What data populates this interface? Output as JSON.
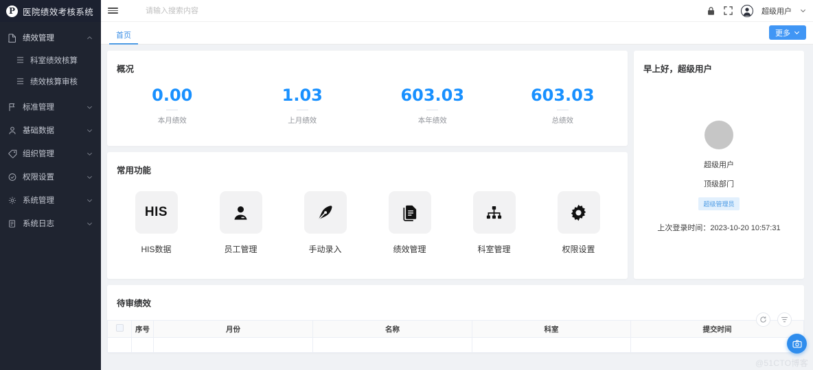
{
  "app": {
    "logo_letter": "P",
    "title": "医院绩效考核系统"
  },
  "sidebar": {
    "items": [
      {
        "label": "绩效管理",
        "icon": "document-icon",
        "expanded": true,
        "children": [
          {
            "label": "科室绩效核算",
            "icon": "list-icon"
          },
          {
            "label": "绩效核算审核",
            "icon": "list-icon"
          }
        ]
      },
      {
        "label": "标准管理",
        "icon": "flag-icon",
        "expanded": false
      },
      {
        "label": "基础数据",
        "icon": "user-icon",
        "expanded": false
      },
      {
        "label": "组织管理",
        "icon": "tag-icon",
        "expanded": false
      },
      {
        "label": "权限设置",
        "icon": "shield-check-icon",
        "expanded": false
      },
      {
        "label": "系统管理",
        "icon": "gear-icon",
        "expanded": false
      },
      {
        "label": "系统日志",
        "icon": "book-icon",
        "expanded": false
      }
    ]
  },
  "topbar": {
    "menu_toggle": "hamburger-icon",
    "search_placeholder": "请输入搜索内容",
    "lock_icon": "lock-icon",
    "fullscreen_icon": "fullscreen-icon",
    "user_name": "超级用户"
  },
  "tabbar": {
    "tabs": [
      {
        "label": "首页",
        "active": true
      }
    ],
    "more_label": "更多"
  },
  "overview": {
    "title": "概况",
    "stats": [
      {
        "value": "0.00",
        "label": "本月绩效"
      },
      {
        "value": "1.03",
        "label": "上月绩效"
      },
      {
        "value": "603.03",
        "label": "本年绩效"
      },
      {
        "value": "603.03",
        "label": "总绩效"
      }
    ]
  },
  "common_functions": {
    "title": "常用功能",
    "items": [
      {
        "label": "HIS数据",
        "icon": "his-text-icon",
        "text": "HIS"
      },
      {
        "label": "员工管理",
        "icon": "person-icon"
      },
      {
        "label": "手动录入",
        "icon": "pen-nib-icon"
      },
      {
        "label": "绩效管理",
        "icon": "documents-icon"
      },
      {
        "label": "科室管理",
        "icon": "org-tree-icon"
      },
      {
        "label": "权限设置",
        "icon": "gear-icon"
      }
    ]
  },
  "greeting": {
    "title": "早上好，超级用户",
    "avatar": "avatar-placeholder",
    "name": "超级用户",
    "department": "顶级部门",
    "role_badge": "超级管理员",
    "last_login_label": "上次登录时间：",
    "last_login_value": "2023-10-20 10:57:31"
  },
  "pending": {
    "title": "待审绩效",
    "tools": [
      {
        "icon": "refresh-icon"
      },
      {
        "icon": "column-settings-icon"
      }
    ],
    "columns": [
      "",
      "序号",
      "月份",
      "名称",
      "科室",
      "提交时间"
    ],
    "rows": []
  },
  "fab": {
    "icon": "camera-icon"
  },
  "watermark": "@51CTO博客",
  "colors": {
    "sidebar_bg": "#1f2430",
    "accent": "#1890ff",
    "button_blue": "#4096f5",
    "page_bg": "#f0f2f5",
    "badge_bg": "#e2f0fd"
  }
}
